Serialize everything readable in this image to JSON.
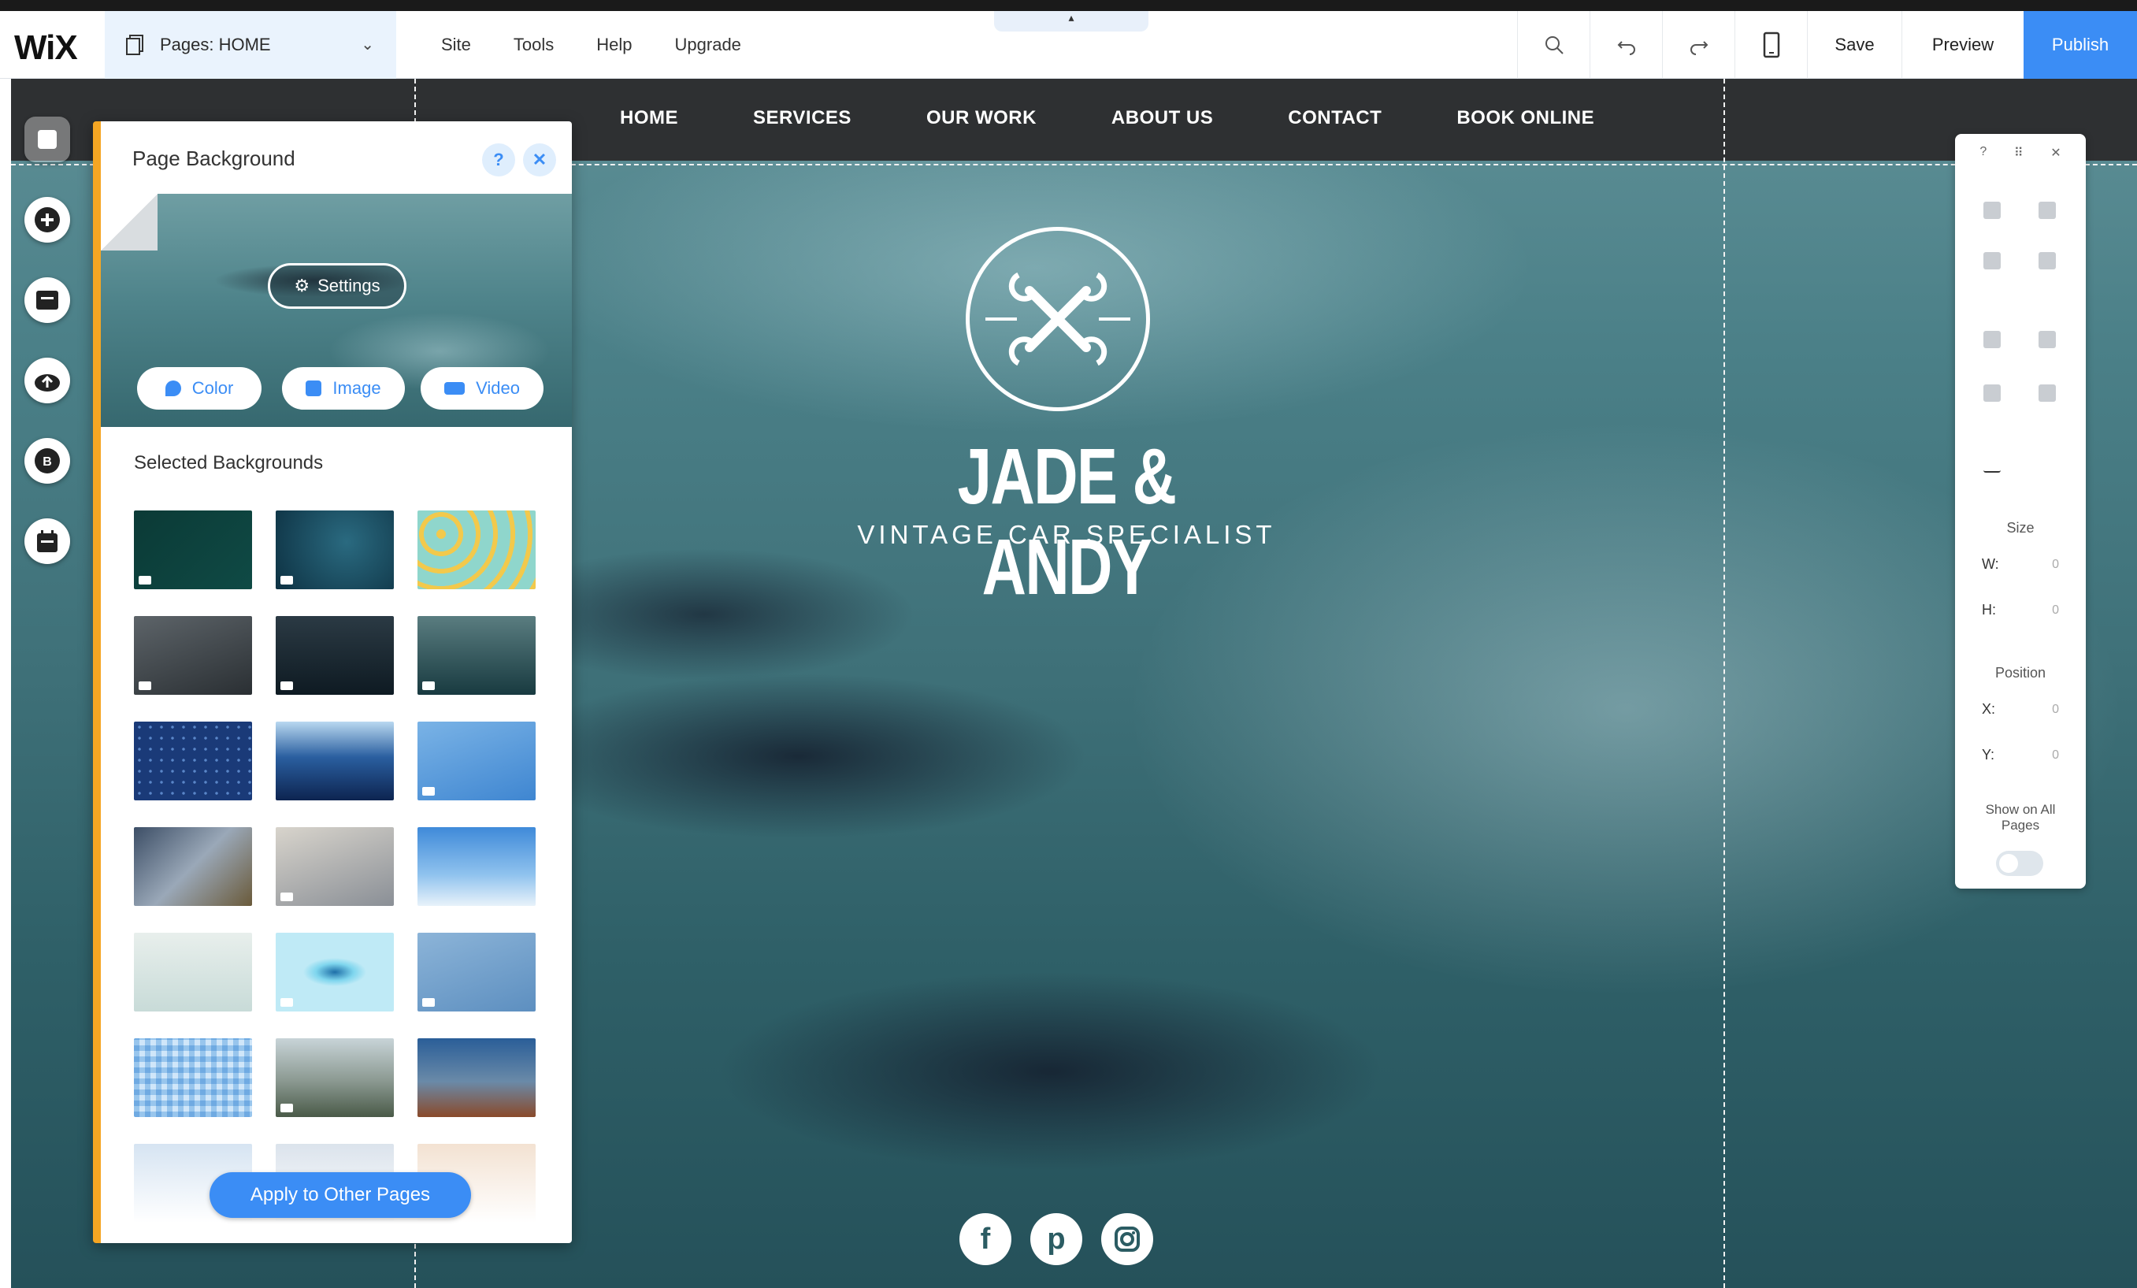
{
  "topbar": {
    "logo": "WiX",
    "pages_label": "Pages: HOME",
    "menu": [
      "Site",
      "Tools",
      "Help",
      "Upgrade"
    ],
    "save_label": "Save",
    "preview_label": "Preview",
    "publish_label": "Publish",
    "accent_color": "#3b8df5"
  },
  "site": {
    "nav": [
      "HOME",
      "SERVICES",
      "OUR WORK",
      "ABOUT US",
      "CONTACT",
      "BOOK ONLINE"
    ],
    "title": "JADE & ANDY",
    "subtitle": "VINTAGE CAR SPECIALIST",
    "social": [
      "facebook-icon",
      "pinterest-icon",
      "instagram-icon"
    ]
  },
  "left_toolbar": [
    "background-icon",
    "add-icon",
    "app-market-icon",
    "upload-icon",
    "blog-icon",
    "bookings-icon"
  ],
  "bg_panel": {
    "title": "Page Background",
    "settings_label": "Settings",
    "type_buttons": [
      "Color",
      "Image",
      "Video"
    ],
    "selected_title": "Selected Backgrounds",
    "apply_label": "Apply to Other Pages",
    "accent_color": "#f5a623"
  },
  "right_panel": {
    "size_label": "Size",
    "w_label": "W:",
    "h_label": "H:",
    "position_label": "Position",
    "x_label": "X:",
    "y_label": "Y:",
    "field_value": "0",
    "show_all_label": "Show on All Pages"
  }
}
